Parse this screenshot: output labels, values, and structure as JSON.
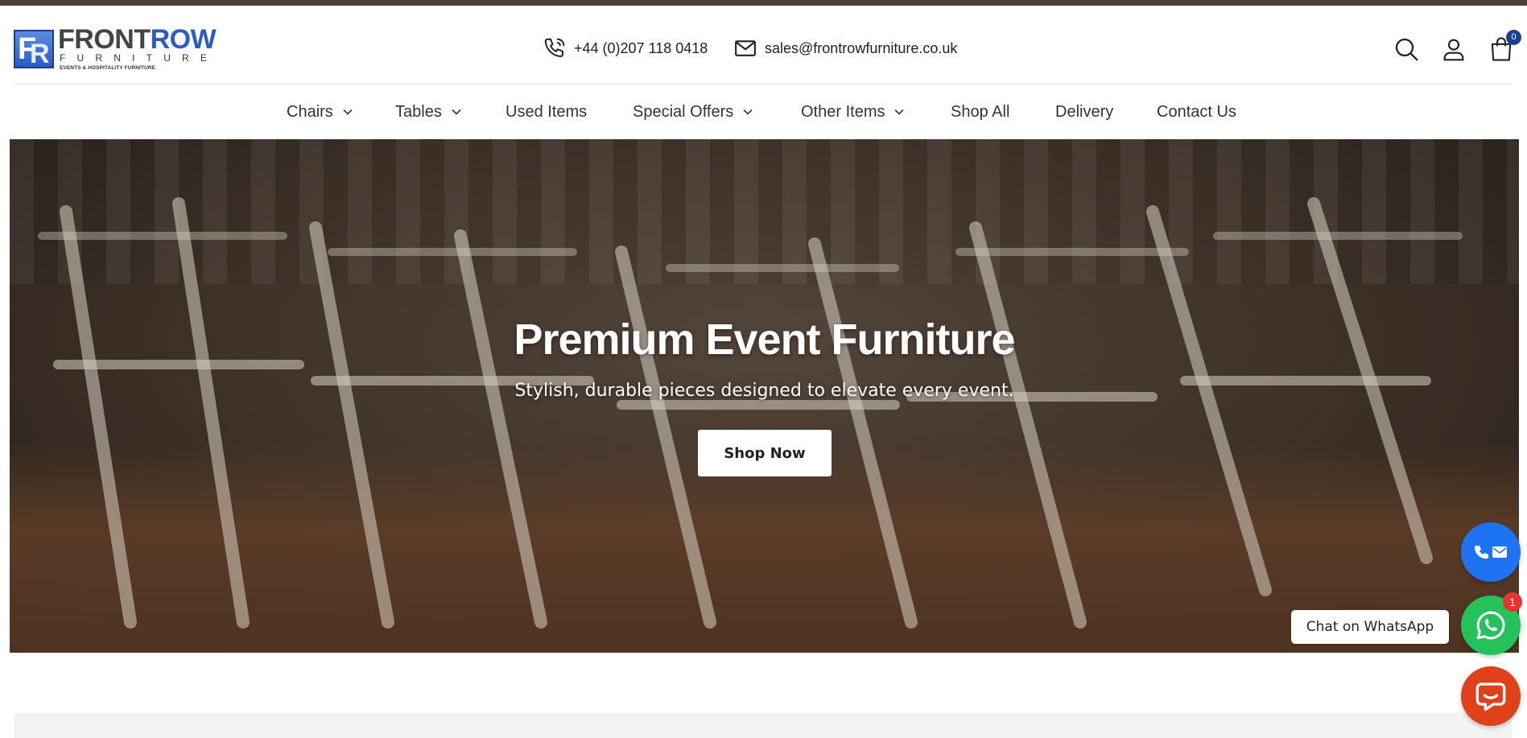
{
  "brand": {
    "name_part1": "FRONT",
    "name_part2": "ROW",
    "sub": "FURNITURE",
    "tagline": "EVENTS & HOSPITALITY FURNITURE",
    "mark": "FR"
  },
  "contact": {
    "phone": "+44 (0)207 118 0418",
    "email": "sales@frontrowfurniture.co.uk"
  },
  "cart": {
    "count": "0"
  },
  "nav": {
    "items": [
      {
        "label": "Chairs",
        "has_dropdown": true
      },
      {
        "label": "Tables",
        "has_dropdown": true
      },
      {
        "label": "Used Items",
        "has_dropdown": false
      },
      {
        "label": "Special Offers",
        "has_dropdown": true
      },
      {
        "label": "Other Items",
        "has_dropdown": true
      },
      {
        "label": "Shop All",
        "has_dropdown": false
      },
      {
        "label": "Delivery",
        "has_dropdown": false
      },
      {
        "label": "Contact Us",
        "has_dropdown": false
      }
    ]
  },
  "hero": {
    "title": "Premium Event Furniture",
    "subtitle": "Stylish, durable pieces designed to elevate every event.",
    "cta": "Shop Now"
  },
  "widgets": {
    "whatsapp_label": "Chat on WhatsApp",
    "whatsapp_badge": "1"
  },
  "colors": {
    "topbar": "#4a3e36",
    "brand_blue": "#2a5cc4",
    "whatsapp_green": "#25c15b",
    "contact_blue": "#1e74f0",
    "chat_orange": "#e0401a"
  },
  "icons": [
    "phone-icon",
    "mail-icon",
    "search-icon",
    "user-icon",
    "bag-icon",
    "chevron-down-icon",
    "whatsapp-icon",
    "chat-icon"
  ]
}
